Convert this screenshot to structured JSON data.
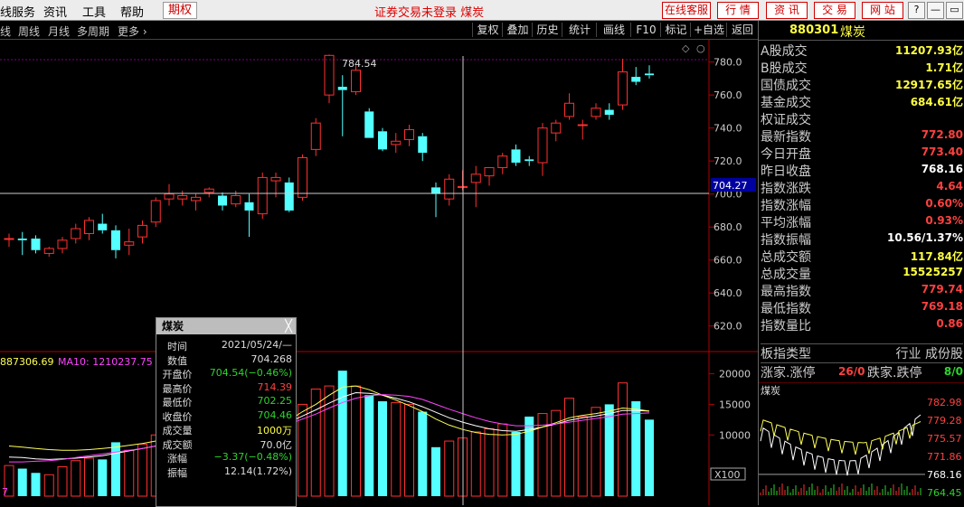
{
  "menubar": {
    "items": [
      "线服务",
      "资讯",
      "工具",
      "帮助"
    ],
    "highlight": "期权",
    "center_text": "证券交易未登录  煤炭",
    "right_buttons": [
      "在线客服",
      "行 情",
      "资 讯",
      "交 易",
      "网 站"
    ],
    "win_controls": [
      "?",
      "—",
      "▭",
      "✕"
    ]
  },
  "toolbar": {
    "periods": [
      "线",
      "周线",
      "月线",
      "多周期",
      "更多 ›"
    ],
    "tools": [
      "复权",
      "叠加",
      "历史",
      "统计",
      "画线",
      "F10",
      "标记",
      "+自选",
      "返回"
    ]
  },
  "price_chart": {
    "y_ticks": [
      "780.0",
      "760.0",
      "740.0",
      "720.0",
      "700.0",
      "680.0",
      "660.0",
      "640.0",
      "620.0"
    ],
    "cursor_price": "704.27",
    "high_label": "784.54",
    "corner_icons": [
      "◇",
      "○"
    ]
  },
  "volume_chart": {
    "legend_vol": "887306.69",
    "legend_ma10": "MA10: 1210237.75",
    "y_ticks": [
      "20000",
      "15000",
      "10000"
    ],
    "unit": "X100",
    "bottom_left": "7"
  },
  "colors": {
    "up": "#ff3030",
    "down": "#54ffff",
    "ma_yellow": "#ffff55",
    "ma_magenta": "#ff44ff",
    "ma_white": "#ffffff"
  },
  "chart_data": {
    "type": "candlestick",
    "title": "煤炭",
    "ylim": [
      610,
      788
    ],
    "candles": [
      {
        "o": 673,
        "h": 676,
        "l": 668,
        "c": 673
      },
      {
        "o": 673,
        "h": 677,
        "l": 663,
        "c": 672
      },
      {
        "o": 673,
        "h": 675,
        "l": 664,
        "c": 666
      },
      {
        "o": 664,
        "h": 668,
        "l": 662,
        "c": 667
      },
      {
        "o": 667,
        "h": 674,
        "l": 664,
        "c": 672
      },
      {
        "o": 673,
        "h": 682,
        "l": 670,
        "c": 679
      },
      {
        "o": 676,
        "h": 686,
        "l": 672,
        "c": 684
      },
      {
        "o": 682,
        "h": 688,
        "l": 676,
        "c": 678
      },
      {
        "o": 678,
        "h": 681,
        "l": 661,
        "c": 666
      },
      {
        "o": 669,
        "h": 679,
        "l": 663,
        "c": 671
      },
      {
        "o": 674,
        "h": 684,
        "l": 670,
        "c": 681
      },
      {
        "o": 683,
        "h": 698,
        "l": 680,
        "c": 696
      },
      {
        "o": 697,
        "h": 706,
        "l": 693,
        "c": 700
      },
      {
        "o": 697,
        "h": 702,
        "l": 693,
        "c": 699
      },
      {
        "o": 696,
        "h": 700,
        "l": 690,
        "c": 698
      },
      {
        "o": 701,
        "h": 704,
        "l": 698,
        "c": 703
      },
      {
        "o": 699,
        "h": 701,
        "l": 690,
        "c": 693
      },
      {
        "o": 694,
        "h": 702,
        "l": 692,
        "c": 699
      },
      {
        "o": 695,
        "h": 700,
        "l": 674,
        "c": 690
      },
      {
        "o": 688,
        "h": 713,
        "l": 685,
        "c": 710
      },
      {
        "o": 708,
        "h": 713,
        "l": 698,
        "c": 710
      },
      {
        "o": 707,
        "h": 710,
        "l": 689,
        "c": 690
      },
      {
        "o": 698,
        "h": 724,
        "l": 696,
        "c": 722
      },
      {
        "o": 727,
        "h": 746,
        "l": 723,
        "c": 743
      },
      {
        "o": 760,
        "h": 784.5,
        "l": 755,
        "c": 784
      },
      {
        "o": 765,
        "h": 772,
        "l": 735,
        "c": 763
      },
      {
        "o": 762,
        "h": 778,
        "l": 760,
        "c": 775
      },
      {
        "o": 750,
        "h": 752,
        "l": 734,
        "c": 734
      },
      {
        "o": 738,
        "h": 740,
        "l": 726,
        "c": 727
      },
      {
        "o": 730,
        "h": 737,
        "l": 725,
        "c": 732
      },
      {
        "o": 733,
        "h": 742,
        "l": 729,
        "c": 739
      },
      {
        "o": 735,
        "h": 737,
        "l": 720,
        "c": 725
      },
      {
        "o": 704,
        "h": 707,
        "l": 686,
        "c": 700
      },
      {
        "o": 697,
        "h": 712,
        "l": 693,
        "c": 709
      },
      {
        "o": 704.5,
        "h": 714.4,
        "l": 702.3,
        "c": 704.5
      },
      {
        "o": 707,
        "h": 717,
        "l": 692,
        "c": 712
      },
      {
        "o": 711,
        "h": 716,
        "l": 705,
        "c": 716
      },
      {
        "o": 716,
        "h": 725,
        "l": 712,
        "c": 723
      },
      {
        "o": 727,
        "h": 730,
        "l": 717,
        "c": 719
      },
      {
        "o": 721,
        "h": 723,
        "l": 717,
        "c": 720
      },
      {
        "o": 719,
        "h": 743,
        "l": 711,
        "c": 740
      },
      {
        "o": 737,
        "h": 745,
        "l": 732,
        "c": 743
      },
      {
        "o": 747,
        "h": 761,
        "l": 745,
        "c": 755
      },
      {
        "o": 742,
        "h": 745,
        "l": 733,
        "c": 742
      },
      {
        "o": 747,
        "h": 755,
        "l": 745,
        "c": 752
      },
      {
        "o": 751,
        "h": 755,
        "l": 745,
        "c": 748
      },
      {
        "o": 754,
        "h": 782,
        "l": 751,
        "c": 774
      },
      {
        "o": 771,
        "h": 777,
        "l": 766,
        "c": 768
      },
      {
        "o": 773,
        "h": 778,
        "l": 770,
        "c": 772
      }
    ],
    "volumes": [
      5000,
      4500,
      3800,
      3500,
      4800,
      5800,
      6200,
      6000,
      8800,
      7500,
      8500,
      10000,
      11000,
      10000,
      10500,
      10500,
      8000,
      9500,
      10000,
      13800,
      13000,
      12000,
      15000,
      17500,
      18000,
      20500,
      18000,
      16500,
      15500,
      15300,
      15000,
      13800,
      8000,
      9000,
      9500,
      10500,
      11000,
      11800,
      10500,
      13000,
      13500,
      14000,
      16000,
      13000,
      14500,
      15000,
      18500,
      15500,
      12500
    ],
    "ma_yellow": [
      8200,
      8000,
      7800,
      7600,
      7500,
      7500,
      7600,
      7800,
      8000,
      8300,
      8600,
      9000,
      9400,
      9700,
      10000,
      10300,
      10400,
      10500,
      10500,
      11200,
      11800,
      12400,
      13800,
      15000,
      16500,
      17800,
      18000,
      17400,
      16500,
      15700,
      14800,
      13800,
      12600,
      11600,
      10900,
      10400,
      10100,
      10000,
      10100,
      10600,
      11300,
      12000,
      12800,
      13200,
      13500,
      13900,
      14400,
      14200,
      13900
    ],
    "ma_magenta": [
      5600,
      5600,
      5700,
      5800,
      6000,
      6300,
      6600,
      6900,
      7200,
      7500,
      7800,
      8200,
      8600,
      9000,
      9400,
      9800,
      10100,
      10300,
      10500,
      10900,
      11300,
      11800,
      12600,
      13400,
      14400,
      15300,
      16000,
      16400,
      16600,
      16500,
      16300,
      15800,
      15000,
      14200,
      13500,
      12800,
      12200,
      11800,
      11500,
      11500,
      11600,
      11800,
      12100,
      12400,
      12700,
      13000,
      13400,
      13500,
      13600
    ],
    "ma_white": [
      6400,
      6300,
      6100,
      6000,
      6100,
      6200,
      6400,
      6600,
      7000,
      7400,
      7800,
      8200,
      8600,
      9000,
      9500,
      9900,
      10200,
      10400,
      10600,
      11100,
      11600,
      12100,
      13100,
      14100,
      15200,
      16200,
      16900,
      16800,
      16500,
      16000,
      15400,
      14600,
      13700,
      12800,
      12100,
      11500,
      11000,
      10700,
      10600,
      10900,
      11300,
      11800,
      12400,
      12800,
      13100,
      13500,
      14000,
      14000,
      13900
    ]
  },
  "tooltip": {
    "title": "煤炭",
    "close": "╳",
    "rows": [
      {
        "k": "时间",
        "v": "2021/05/24/—",
        "color": "#dddddd"
      },
      {
        "k": "数值",
        "v": "704.268",
        "color": "#dddddd"
      },
      {
        "k": "开盘价",
        "v": "704.54(−0.46%)",
        "color": "#2dd52d"
      },
      {
        "k": "最高价",
        "v": "714.39",
        "color": "#ff4040"
      },
      {
        "k": "最低价",
        "v": "702.25",
        "color": "#2dd52d"
      },
      {
        "k": "收盘价",
        "v": "704.46",
        "color": "#2dd52d"
      },
      {
        "k": "成交量",
        "v": "1000万",
        "color": "#ffff40"
      },
      {
        "k": "成交额",
        "v": "70.0亿",
        "color": "#dddddd"
      },
      {
        "k": "涨幅",
        "v": "−3.37(−0.48%)",
        "color": "#2dd52d"
      },
      {
        "k": "振幅",
        "v": "12.14(1.72%)",
        "color": "#dddddd"
      }
    ]
  },
  "panel": {
    "code": "880301",
    "name": "煤炭",
    "rows": [
      {
        "label": "A股成交",
        "value": "11207.93亿",
        "color": "#ffff40"
      },
      {
        "label": "B股成交",
        "value": "1.71亿",
        "color": "#ffff40"
      },
      {
        "label": "国债成交",
        "value": "12917.65亿",
        "color": "#ffff40"
      },
      {
        "label": "基金成交",
        "value": "684.61亿",
        "color": "#ffff40"
      },
      {
        "label": "权证成交",
        "value": "",
        "color": "#ffff40"
      },
      {
        "label": "最新指数",
        "value": "772.80",
        "color": "#ff4040"
      },
      {
        "label": "今日开盘",
        "value": "773.40",
        "color": "#ff4040"
      },
      {
        "label": "昨日收盘",
        "value": "768.16",
        "color": "#ffffff"
      },
      {
        "label": "指数涨跌",
        "value": "4.64",
        "color": "#ff4040"
      },
      {
        "label": "指数涨幅",
        "value": "0.60%",
        "color": "#ff4040"
      },
      {
        "label": "平均涨幅",
        "value": "0.93%",
        "color": "#ff4040"
      },
      {
        "label": "指数振幅",
        "value": "10.56/1.37%",
        "color": "#ffffff"
      },
      {
        "label": "总成交额",
        "value": "117.84亿",
        "color": "#ffff40"
      },
      {
        "label": "总成交量",
        "value": "15525257",
        "color": "#ffff40"
      },
      {
        "label": "最高指数",
        "value": "779.74",
        "color": "#ff4040"
      },
      {
        "label": "最低指数",
        "value": "769.18",
        "color": "#ff4040"
      },
      {
        "label": "指数量比",
        "value": "0.86",
        "color": "#ff4040"
      }
    ],
    "type_label": "板指类型",
    "type_value": "行业 成份股",
    "rise_label": "涨家.涨停",
    "rise_value": "26/0",
    "fall_label": "跌家.跌停",
    "fall_value": "8/0",
    "mini_title": "煤炭",
    "mini_ticks": [
      "782.98",
      "779.28",
      "775.57",
      "771.86",
      "768.16",
      "764.45"
    ]
  }
}
